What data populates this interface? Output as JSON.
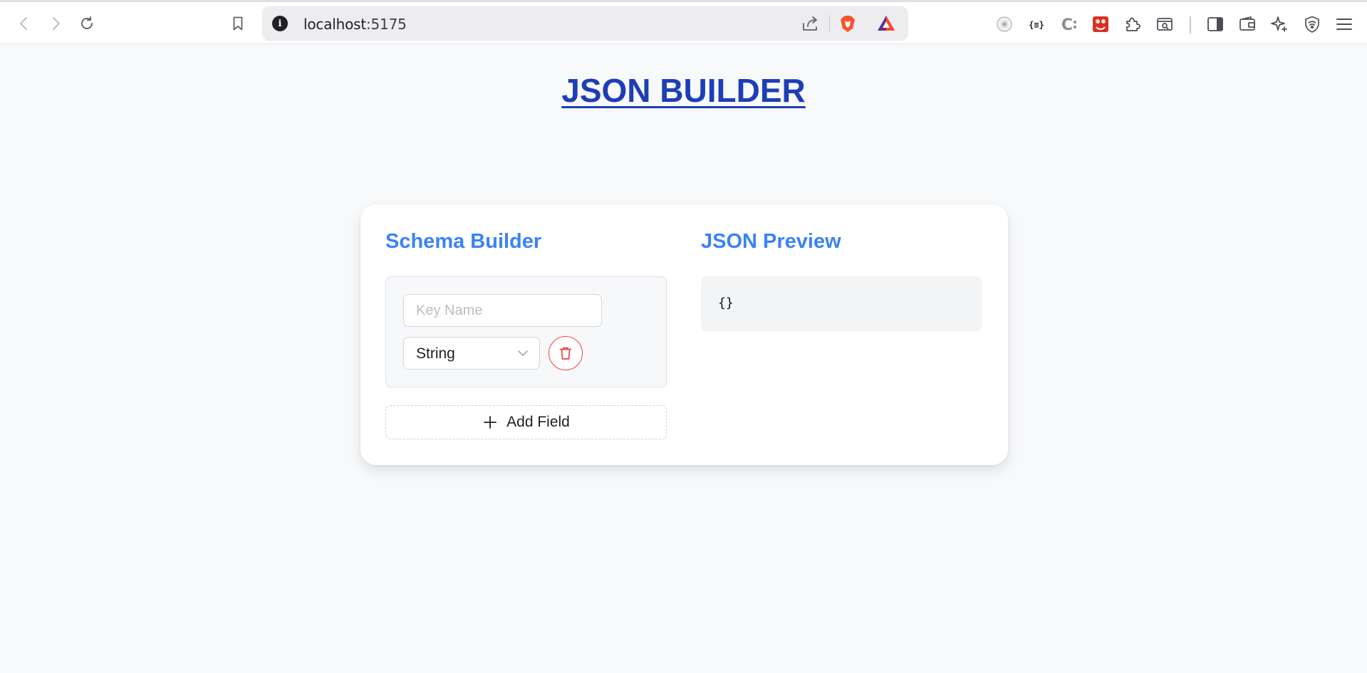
{
  "browser": {
    "url_host": "localhost",
    "url_port": ":5175"
  },
  "page": {
    "title": "JSON BUILDER"
  },
  "schema_builder": {
    "heading": "Schema Builder",
    "fields": [
      {
        "key_placeholder": "Key Name",
        "key_value": "",
        "type_selected": "String"
      }
    ],
    "add_field_label": "Add Field"
  },
  "json_preview": {
    "heading": "JSON Preview",
    "content": "{}"
  },
  "colors": {
    "title": "#1e3eb6",
    "section_heading": "#3b82f6",
    "delete": "#ef4444"
  },
  "icons": {
    "toolbar": [
      "back-icon",
      "forward-icon",
      "reload-icon",
      "bookmark-icon",
      "site-info-icon",
      "share-icon",
      "brave-shields-icon",
      "brave-rewards-icon"
    ],
    "extensions": [
      "extension-face-icon",
      "json-formatter-icon",
      "extension-c-icon",
      "extension-red-icon",
      "extensions-puzzle-icon",
      "capture-icon",
      "sidebar-icon",
      "wallet-icon",
      "leo-ai-icon",
      "vpn-icon",
      "menu-icon"
    ],
    "app": [
      "trash-icon",
      "plus-icon",
      "chevron-down-icon"
    ]
  }
}
